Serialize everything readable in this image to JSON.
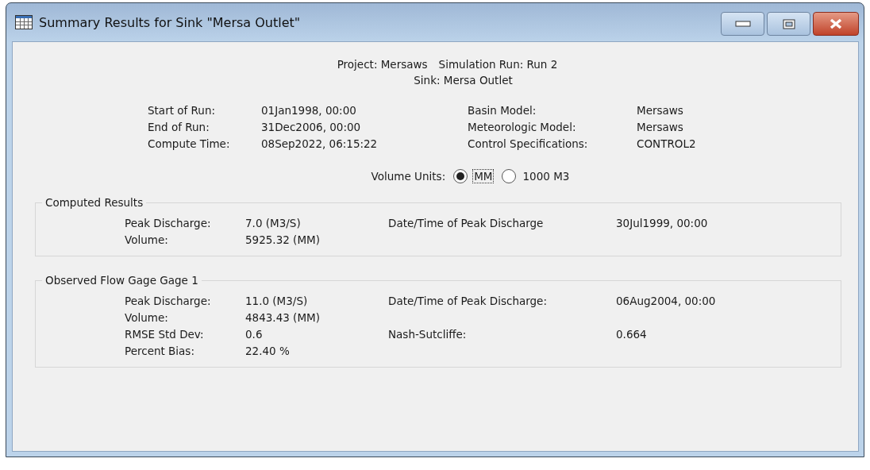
{
  "window": {
    "title": "Summary Results for Sink \"Mersa Outlet\""
  },
  "header": {
    "project": "Project: Mersaws",
    "simulation_run": "Simulation Run: Run 2",
    "sink": "Sink: Mersa Outlet"
  },
  "run_info": [
    {
      "left": {
        "label": "Start of Run:",
        "value": "01Jan1998, 00:00"
      },
      "right": {
        "label": "Basin Model:",
        "value": "Mersaws"
      }
    },
    {
      "left": {
        "label": "End of Run:",
        "value": "31Dec2006, 00:00"
      },
      "right": {
        "label": "Meteorologic Model:",
        "value": "Mersaws"
      }
    },
    {
      "left": {
        "label": "Compute Time:",
        "value": "08Sep2022, 06:15:22"
      },
      "right": {
        "label": "Control Specifications:",
        "value": "CONTROL2"
      }
    }
  ],
  "volume_units": {
    "label": "Volume Units:",
    "options": [
      {
        "label": "MM",
        "selected": true
      },
      {
        "label": "1000 M3",
        "selected": false
      }
    ]
  },
  "groups": [
    {
      "title": "Computed Results",
      "rows": [
        {
          "left": {
            "label": "Peak Discharge:",
            "value": "7.0 (M3/S)"
          },
          "right": {
            "label": "Date/Time of Peak Discharge",
            "value": "30Jul1999, 00:00"
          }
        },
        {
          "left": {
            "label": "Volume:",
            "value": "5925.32 (MM)"
          }
        }
      ]
    },
    {
      "title": "Observed Flow Gage Gage 1",
      "rows": [
        {
          "left": {
            "label": "Peak Discharge:",
            "value": "11.0 (M3/S)"
          },
          "right": {
            "label": "Date/Time of Peak Discharge:",
            "value": "06Aug2004, 00:00"
          }
        },
        {
          "left": {
            "label": "Volume:",
            "value": "4843.43 (MM)"
          }
        },
        {
          "left": {
            "label": "RMSE Std Dev:",
            "value": "0.6"
          },
          "right": {
            "label": "Nash-Sutcliffe:",
            "value": "0.664"
          }
        },
        {
          "left": {
            "label": "Percent Bias:",
            "value": "22.40 %"
          }
        }
      ]
    }
  ]
}
